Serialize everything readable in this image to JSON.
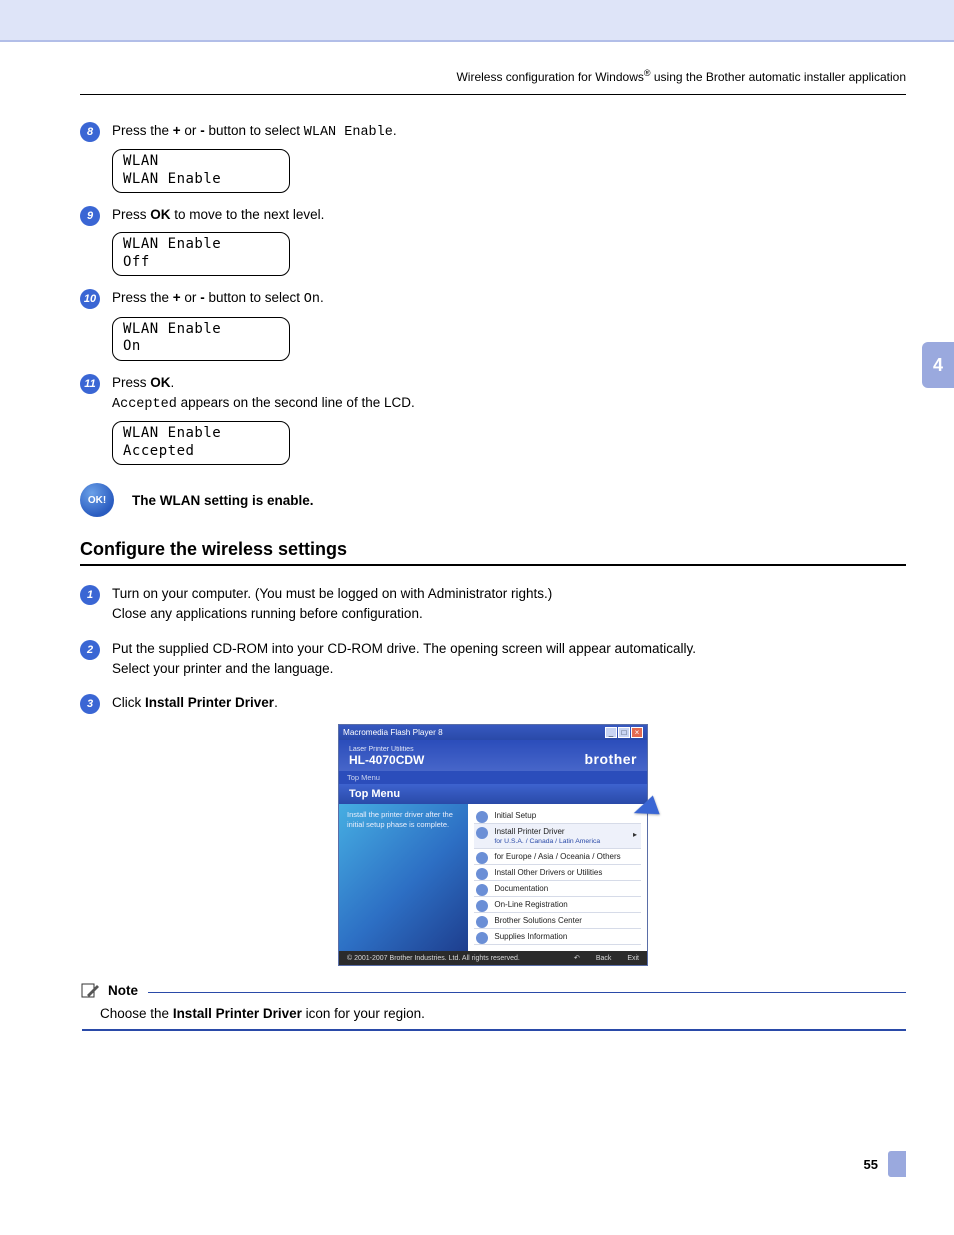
{
  "header": {
    "text_left": "Wireless configuration for Windows",
    "reg": "®",
    "text_right": " using the Brother automatic installer application"
  },
  "side_tab": "4",
  "steps_a": [
    {
      "num": "8",
      "pre": "Press the ",
      "b1": "+",
      "mid1": " or ",
      "b2": "-",
      "mid2": " button to select  ",
      "mono": "WLAN Enable",
      "post": ".",
      "lcd": "WLAN\nWLAN Enable"
    },
    {
      "num": "9",
      "pre": "Press ",
      "b1": "OK",
      "post": " to move to the next level.",
      "lcd": "WLAN Enable\nOff"
    },
    {
      "num": "10",
      "pre": "Press the ",
      "b1": "+",
      "mid1": " or ",
      "b2": "-",
      "mid2": " button to select ",
      "mono": "On",
      "post": ".",
      "lcd": "WLAN Enable\nOn"
    },
    {
      "num": "11",
      "line1_pre": "Press ",
      "line1_b": "OK",
      "line1_post": ".",
      "line2_mono": "Accepted",
      "line2_post": " appears on the second line of the LCD.",
      "lcd": "WLAN Enable\nAccepted"
    }
  ],
  "ok_badge": "OK!",
  "ok_text": "The WLAN setting is enable.",
  "section_title": "Configure the wireless settings",
  "steps_b": [
    {
      "num": "1",
      "line1": "Turn on your computer. (You must be logged on with Administrator rights.)",
      "line2": "Close any applications running before configuration."
    },
    {
      "num": "2",
      "line1": "Put the supplied CD-ROM into your CD-ROM drive. The opening screen will appear automatically.",
      "line2": "Select your printer and the language."
    },
    {
      "num": "3",
      "pre": "Click ",
      "b": "Install Printer Driver",
      "post": "."
    }
  ],
  "installer": {
    "titlebar": "Macromedia Flash Player 8",
    "header_sub": "Laser Printer Utilities",
    "header_model": "HL-4070CDW",
    "header_brand": "brother",
    "tabrow": "Top Menu",
    "topmenu": "Top Menu",
    "left_text": "Install the printer driver after the initial setup phase is complete.",
    "items": [
      {
        "label": "Initial Setup"
      },
      {
        "label": "Install Printer Driver",
        "sub": "for U.S.A. / Canada / Latin America"
      },
      {
        "label": "Install Printer Driver",
        "sub": "for Europe / Asia / Oceania / Others"
      },
      {
        "label": "Install Other Drivers or Utilities"
      },
      {
        "label": "Documentation"
      },
      {
        "label": "On-Line Registration"
      },
      {
        "label": "Brother Solutions Center"
      },
      {
        "label": "Supplies Information"
      }
    ],
    "footer_copy": "© 2001-2007 Brother Industries. Ltd. All rights reserved.",
    "footer_back": "Back",
    "footer_exit": "Exit"
  },
  "note": {
    "label": "Note",
    "body_pre": "Choose the ",
    "body_b": "Install Printer Driver",
    "body_post": " icon for your region."
  },
  "page_number": "55"
}
